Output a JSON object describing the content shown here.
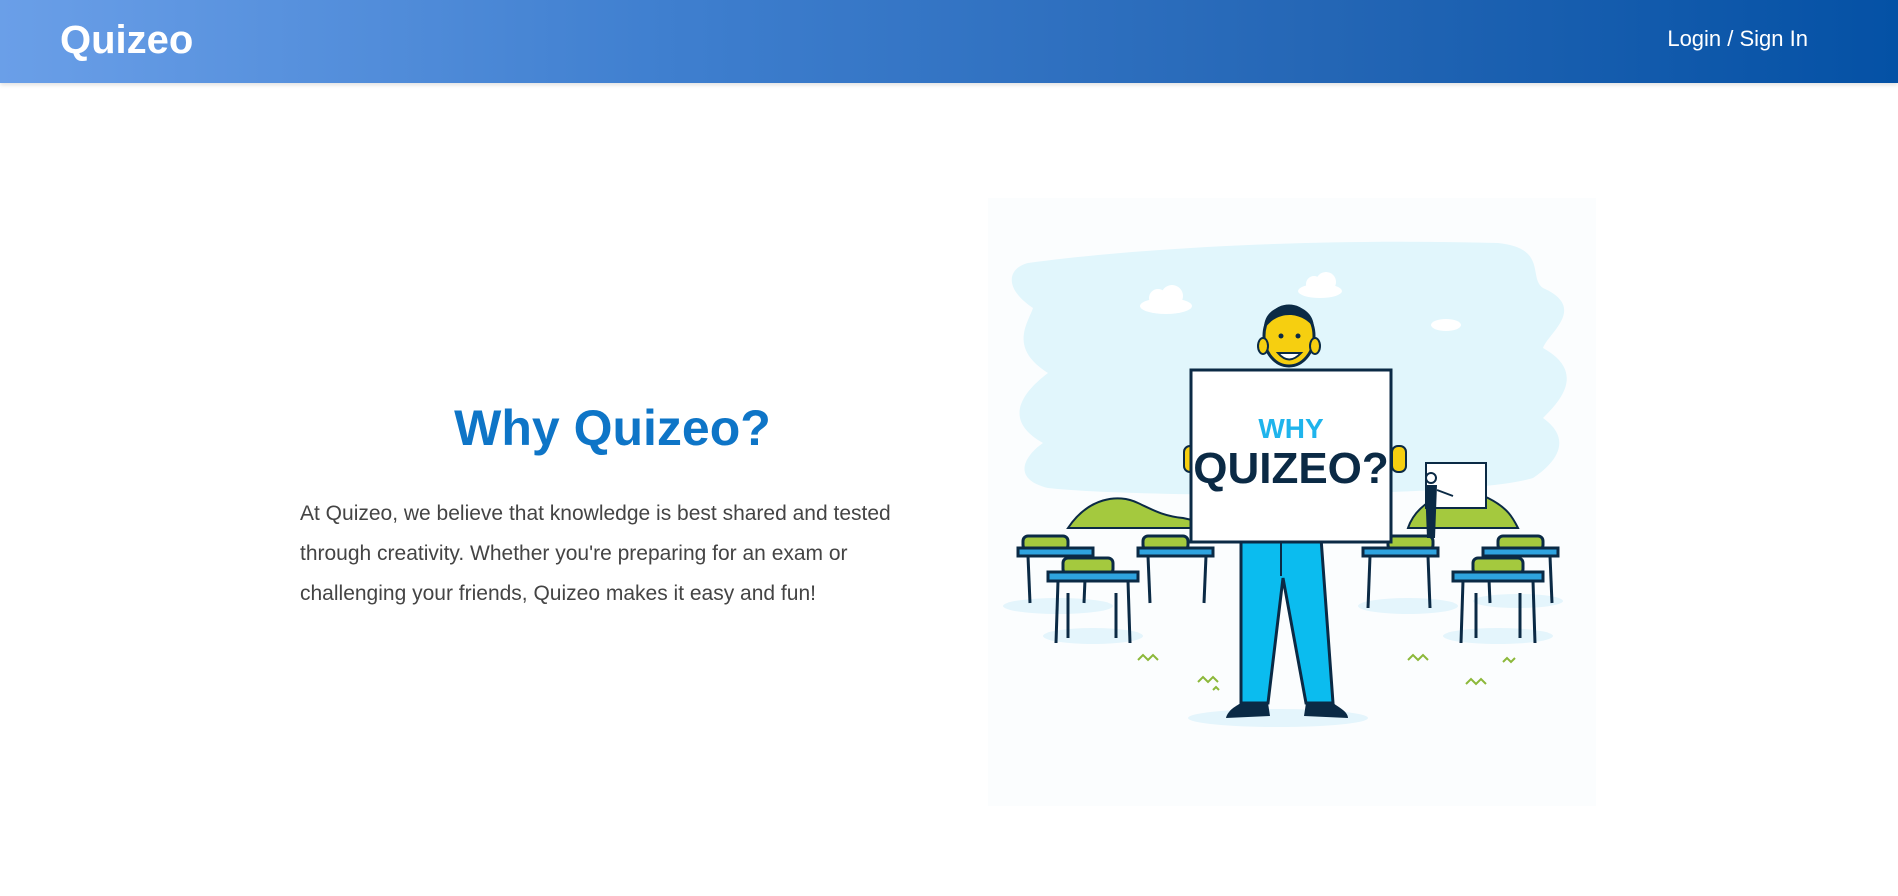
{
  "navbar": {
    "brand": "Quizeo",
    "login_label": "Login / Sign In"
  },
  "main": {
    "heading": "Why Quizeo?",
    "description": "At Quizeo, we believe that knowledge is best shared and tested through creativity. Whether you're preparing for an exam or challenging your friends, Quizeo makes it easy and fun!"
  },
  "illustration": {
    "sign_line1": "WHY",
    "sign_line2": "QUIZEO?"
  },
  "colors": {
    "accent": "#0e75c7",
    "navbar_start": "#6a9fe8",
    "navbar_end": "#0451a5",
    "body_text": "#444444"
  }
}
